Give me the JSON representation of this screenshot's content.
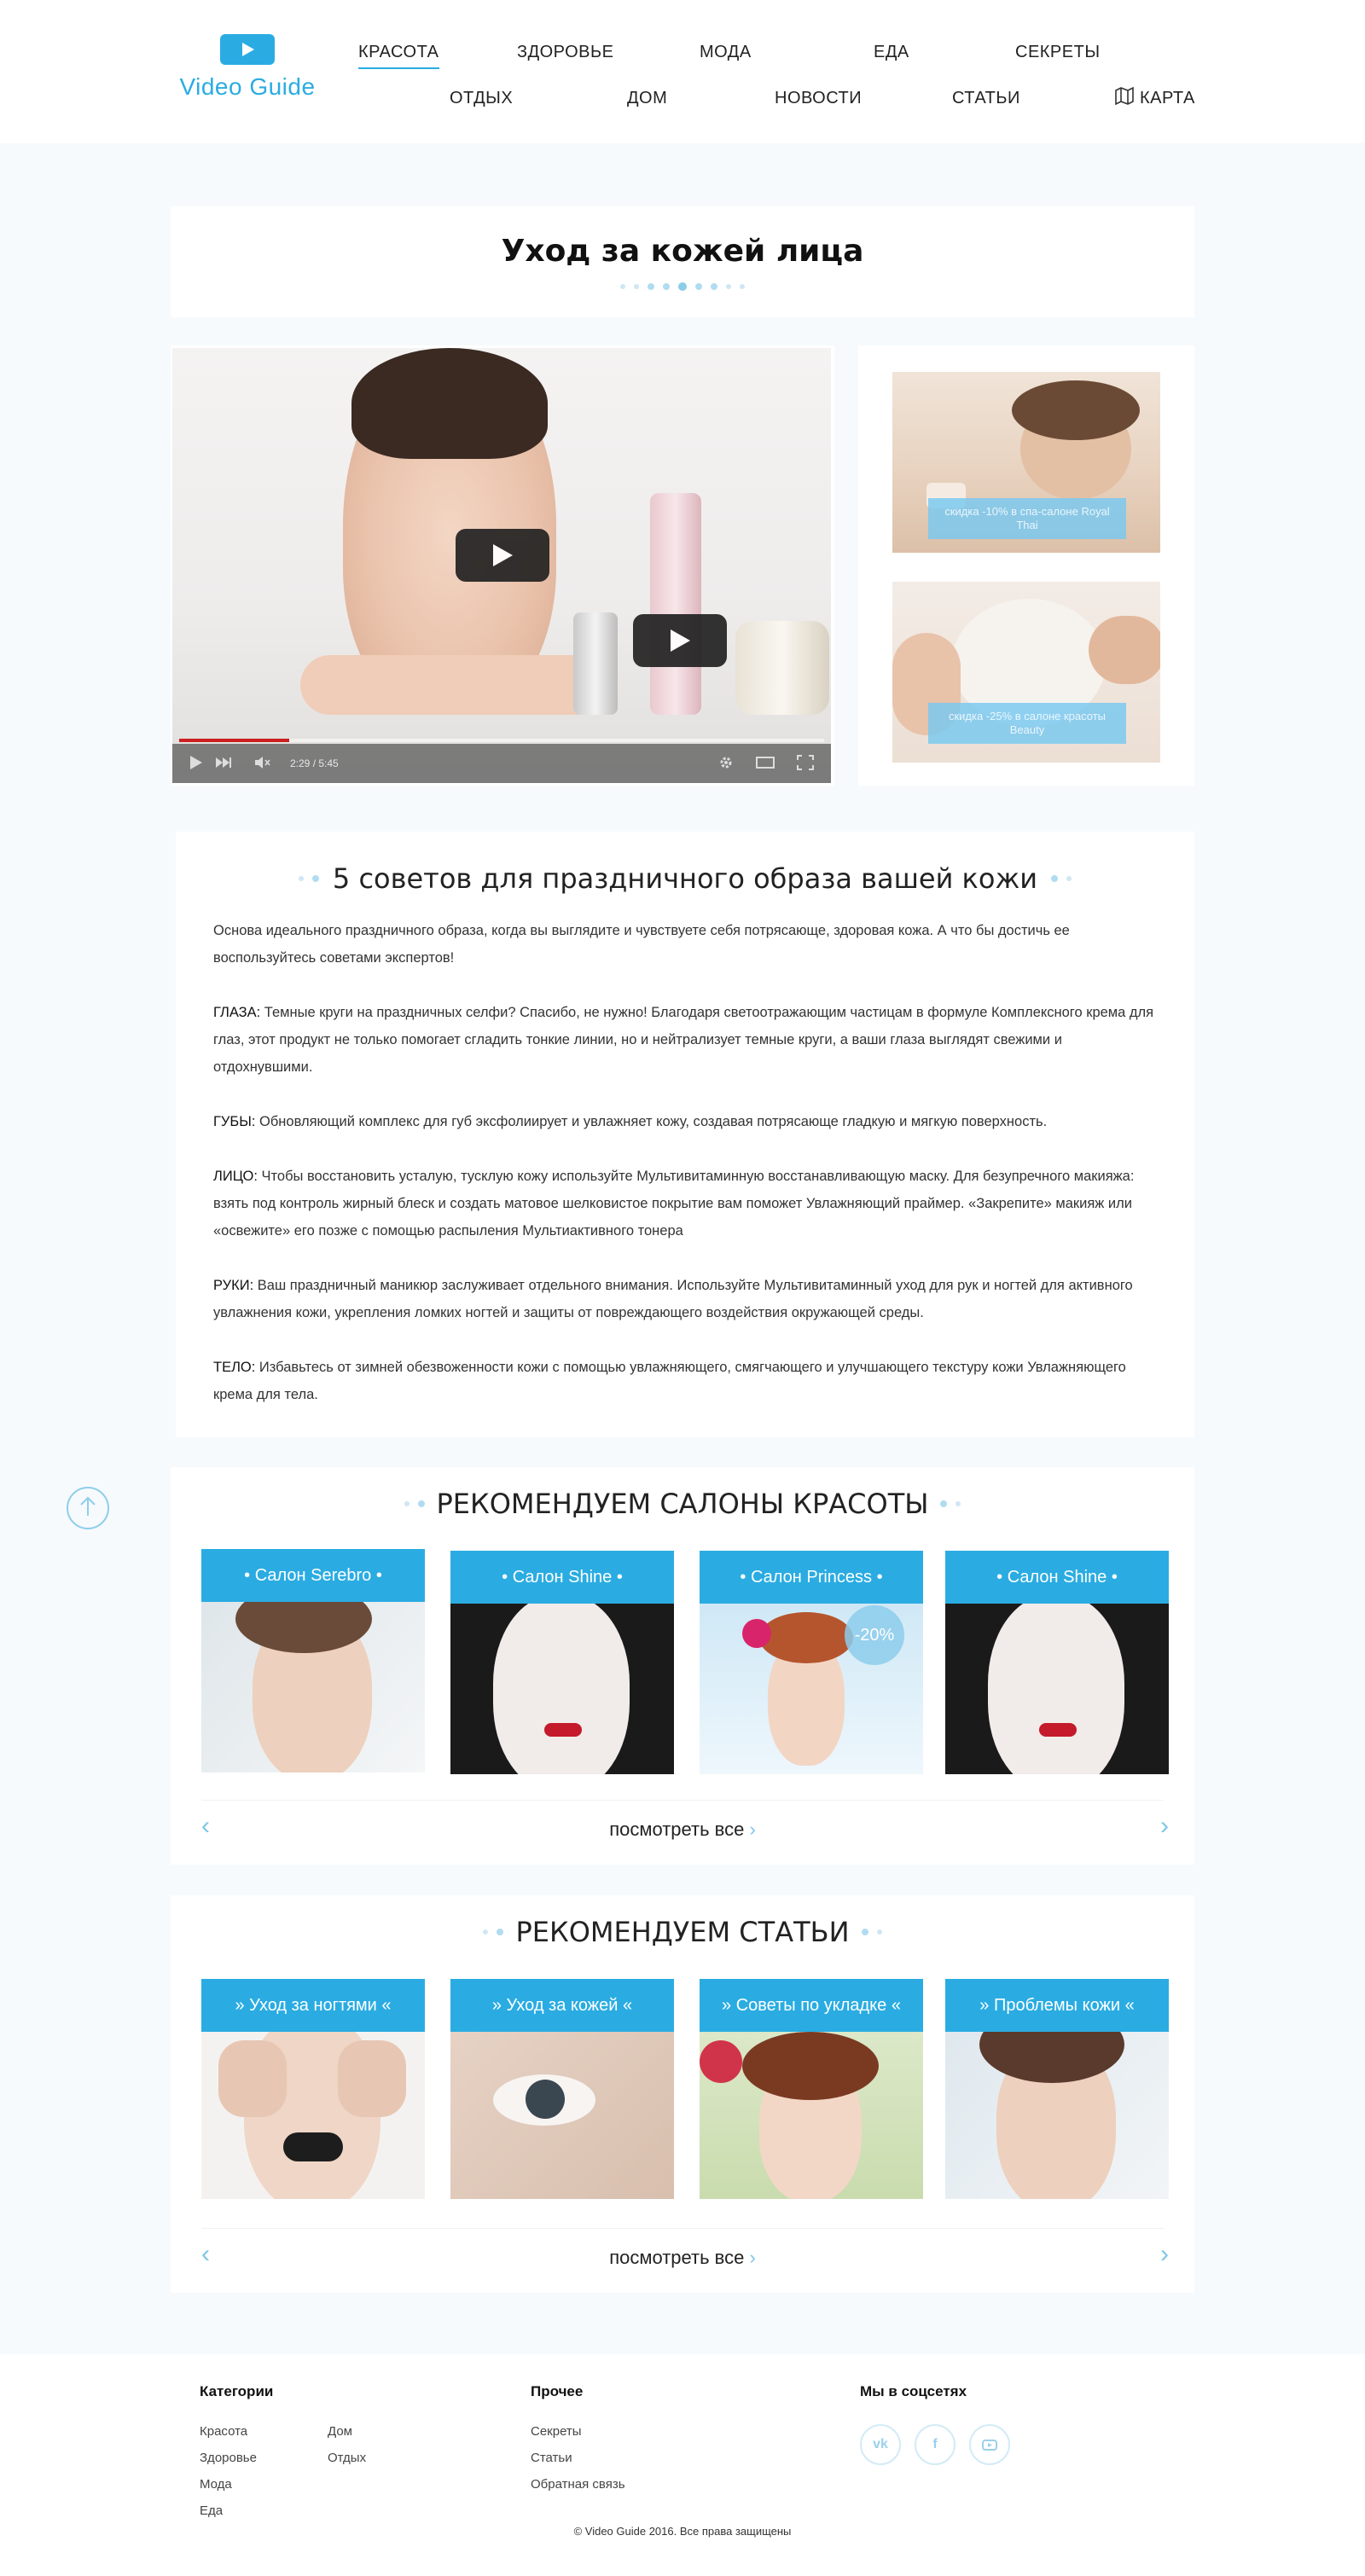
{
  "header": {
    "logo_text": "Video Guide",
    "nav_row1": [
      "КРАСОТА",
      "ЗДОРОВЬЕ",
      "МОДА",
      "ЕДА",
      "СЕКРЕТЫ"
    ],
    "nav_row2": [
      "ОТДЫХ",
      "ДОМ",
      "НОВОСТИ",
      "СТАТЬИ",
      "КАРТА"
    ]
  },
  "page": {
    "title": "Уход за кожей лица"
  },
  "video": {
    "time": "2:29 / 5:45",
    "progress": 0.17
  },
  "promos": [
    {
      "label": "скидка -10% в спа-салоне Royal Thai"
    },
    {
      "label": "скидка -25% в салоне красоты Beauty"
    }
  ],
  "article": {
    "heading": "5 советов для праздничного образа вашей кожи",
    "intro": "Основа идеального праздничного образа, когда вы выглядите и чувствуете себя потрясающе, здоровая кожа. А что бы достичь ее воспользуйтесь советами экспертов!",
    "tips": [
      {
        "label": "ГЛАЗА:",
        "text": " Темные круги на праздничных селфи? Спасибо, не нужно! Благодаря светоотражающим частицам в формуле Комплексного крема для глаз, этот продукт не только помогает сгладить тонкие линии, но и нейтрализует темные круги, а ваши глаза выглядят свежими и отдохнувшими."
      },
      {
        "label": "ГУБЫ:",
        "text": "  Обновляющий комплекс для губ эксфолиирует и увлажняет кожу, создавая потрясающе гладкую и мягкую поверхность."
      },
      {
        "label": "ЛИЦО:",
        "text": " Чтобы восстановить  усталую, тусклую кожу используйте Мультивитаминную восстанавливающую маску.  Для безупречного макияжа: взять под контроль жирный блеск и создать матовое шелковистое покрытие вам поможет  Увлажняющий праймер. «Закрепите» макияж или «освежите» его позже с помощью распыления  Мультиактивного тонера"
      },
      {
        "label": "РУКИ:",
        "text": " Ваш праздничный маникюр заслуживает отдельного внимания. Используйте  Мультивитаминный уход для рук и ногтей для активного увлажнения кожи, укрепления ломких ногтей и защиты от повреждающего воздействия окружающей среды."
      },
      {
        "label": "ТЕЛО:",
        "text": " Избавьтесь от зимней обезвоженности кожи с помощью увлажняющего, смягчающего и улучшающего текстуру кожи Увлажняющего крема для тела."
      }
    ]
  },
  "salons": {
    "heading": "РЕКОМЕНДУЕМ САЛОНЫ КРАСОТЫ",
    "items": [
      {
        "label": "• Салон Serebro •"
      },
      {
        "label": "• Салон Shine •"
      },
      {
        "label": "• Салон Princess •",
        "badge": "-20%"
      },
      {
        "label": "• Салон Shine •"
      }
    ],
    "see_all": "посмотреть все"
  },
  "articles": {
    "heading": "РЕКОМЕНДУЕМ СТАТЬИ",
    "items": [
      {
        "label": "» Уход за ногтями «"
      },
      {
        "label": "» Уход за кожей «"
      },
      {
        "label": "» Советы по укладке «"
      },
      {
        "label": "» Проблемы кожи «"
      }
    ],
    "see_all": "посмотреть все"
  },
  "footer": {
    "categories_title": "Категории",
    "categories_col1": [
      "Красота",
      "Здоровье",
      "Мода",
      "Еда"
    ],
    "categories_col2": [
      "Дом",
      "Отдых"
    ],
    "other_title": "Прочее",
    "other_links": [
      "Секреты",
      "Статьи",
      "Обратная связь"
    ],
    "social_title": "Мы в соцсетях",
    "social": [
      "vk-icon",
      "facebook-icon",
      "youtube-icon"
    ],
    "copyright": "© Video Guide  2016.  Все права защищены"
  },
  "colors": {
    "accent": "#2aace2",
    "page_bg": "#f6fafc"
  }
}
